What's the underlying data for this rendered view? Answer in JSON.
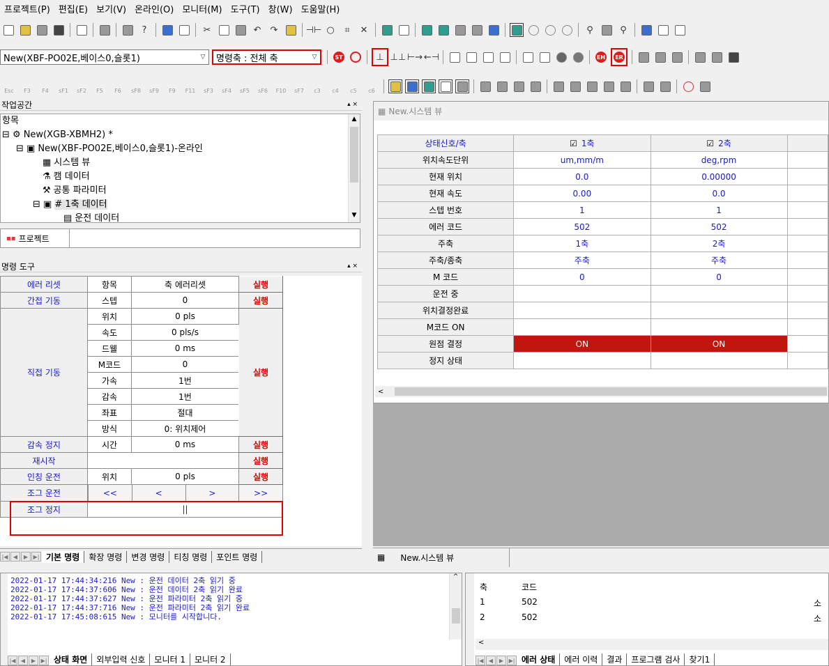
{
  "menu": [
    "프로젝트(P)",
    "편집(E)",
    "보기(V)",
    "온라인(O)",
    "모니터(M)",
    "도구(T)",
    "창(W)",
    "도움말(H)"
  ],
  "toolbar": {
    "module_select": "New(XBF-PO02E,베이스0,슬롯1)",
    "axis_select": "명령축 : 전체 축"
  },
  "fkeys": [
    "Esc",
    "F3",
    "F4",
    "sF1",
    "sF2",
    "F5",
    "F6",
    "sF8",
    "sF9",
    "F9",
    "F11",
    "sF3",
    "sF4",
    "sF5",
    "sF6",
    "F10",
    "sF7",
    "c3",
    "c4",
    "c5",
    "c6"
  ],
  "workspace": {
    "title": "작업공간",
    "close": "▴ ×",
    "column": "항목",
    "items": [
      {
        "label": "New(XGB-XBMH2) *",
        "icon": "project-icon"
      },
      {
        "label": "New(XBF-PO02E,베이스0,슬롯1)-온라인",
        "icon": "module-icon"
      },
      {
        "label": "시스템 뷰",
        "icon": "system-view-icon"
      },
      {
        "label": "캠 데이터",
        "icon": "cam-icon"
      },
      {
        "label": "공통 파라미터",
        "icon": "parameter-icon"
      },
      {
        "label": "# 1축 데이터",
        "icon": "axis-icon"
      },
      {
        "label": "운전 데이터",
        "icon": "data-icon"
      }
    ],
    "tab": "프로젝트"
  },
  "cmdtool": {
    "title": "명령 도구",
    "close": "▴ ×",
    "rows": [
      {
        "label": "에러 리셋",
        "item": "항목",
        "value": "축 에러리셋",
        "run": "실행"
      },
      {
        "label": "간접 기동",
        "item": "스텝",
        "value": "0",
        "run": "실행"
      },
      {
        "label": "직접 기동",
        "sub": [
          {
            "item": "위치",
            "value": "0 pls"
          },
          {
            "item": "속도",
            "value": "0 pls/s"
          },
          {
            "item": "드웰",
            "value": "0 ms"
          },
          {
            "item": "M코드",
            "value": "0"
          },
          {
            "item": "가속",
            "value": "1번"
          },
          {
            "item": "감속",
            "value": "1번"
          },
          {
            "item": "좌표",
            "value": "절대"
          },
          {
            "item": "방식",
            "value": "0: 위치제어"
          }
        ],
        "run": "실행"
      },
      {
        "label": "감속 정지",
        "item": "시간",
        "value": "0 ms",
        "run": "실행"
      },
      {
        "label": "재시작",
        "run": "실행"
      },
      {
        "label": "인칭 운전",
        "item": "위치",
        "value": "0 pls",
        "run": "실행"
      }
    ],
    "jog_label": "조그 운전",
    "jog_buttons": [
      "<<",
      "<",
      ">",
      ">>"
    ],
    "jogstop_label": "조그 정지",
    "jogstop_value": "||",
    "tabs": [
      "기본 명령",
      "확장 명령",
      "변경 명령",
      "티칭 명령",
      "포인트 명령"
    ]
  },
  "sysview": {
    "title": "New.시스템 뷰",
    "header": "상태신호/축",
    "axes": [
      "1축",
      "2축"
    ],
    "rows": [
      {
        "label": "위치속도단위",
        "v": [
          "um,mm/m",
          "deg,rpm"
        ]
      },
      {
        "label": "현재 위치",
        "v": [
          "0.0",
          "0.00000"
        ]
      },
      {
        "label": "현재 속도",
        "v": [
          "0.00",
          "0.0"
        ]
      },
      {
        "label": "스텝 번호",
        "v": [
          "1",
          "1"
        ]
      },
      {
        "label": "에러 코드",
        "v": [
          "502",
          "502"
        ]
      },
      {
        "label": "주축",
        "v": [
          "1축",
          "2축"
        ]
      },
      {
        "label": "주축/종축",
        "v": [
          "주축",
          "주축"
        ]
      },
      {
        "label": "M 코드",
        "v": [
          "0",
          "0"
        ]
      },
      {
        "label": "운전 중",
        "v": [
          "",
          ""
        ]
      },
      {
        "label": "위치결정완료",
        "v": [
          "",
          ""
        ]
      },
      {
        "label": "M코드 ON",
        "v": [
          "",
          ""
        ]
      },
      {
        "label": "원점 결정",
        "v": [
          "ON",
          "ON"
        ],
        "on": true
      },
      {
        "label": "정지 상태",
        "v": [
          "",
          ""
        ]
      }
    ],
    "tab": "New.시스템 뷰"
  },
  "log": {
    "lines": [
      "2022-01-17 17:44:34:216  New : 운전 데이터 2축 읽기 중",
      "2022-01-17 17:44:37:606  New : 운전 데이터 2축 읽기 완료",
      "2022-01-17 17:44:37:627  New : 운전 파라미터 2축 읽기 중",
      "2022-01-17 17:44:37:716  New : 운전 파라미터 2축 읽기 완료",
      "2022-01-17 17:45:08:615  New : 모니터를 시작합니다."
    ],
    "tabs": [
      "상태 화면",
      "외부입력 신호",
      "모니터 1",
      "모니터 2"
    ]
  },
  "errors": {
    "columns": [
      "축",
      "코드"
    ],
    "rows": [
      {
        "axis": "1",
        "code": "502",
        "tail": "소"
      },
      {
        "axis": "2",
        "code": "502",
        "tail": "소"
      }
    ],
    "tabs": [
      "에러 상태",
      "에러 이력",
      "결과",
      "프로그램 검사",
      "찾기1"
    ]
  }
}
